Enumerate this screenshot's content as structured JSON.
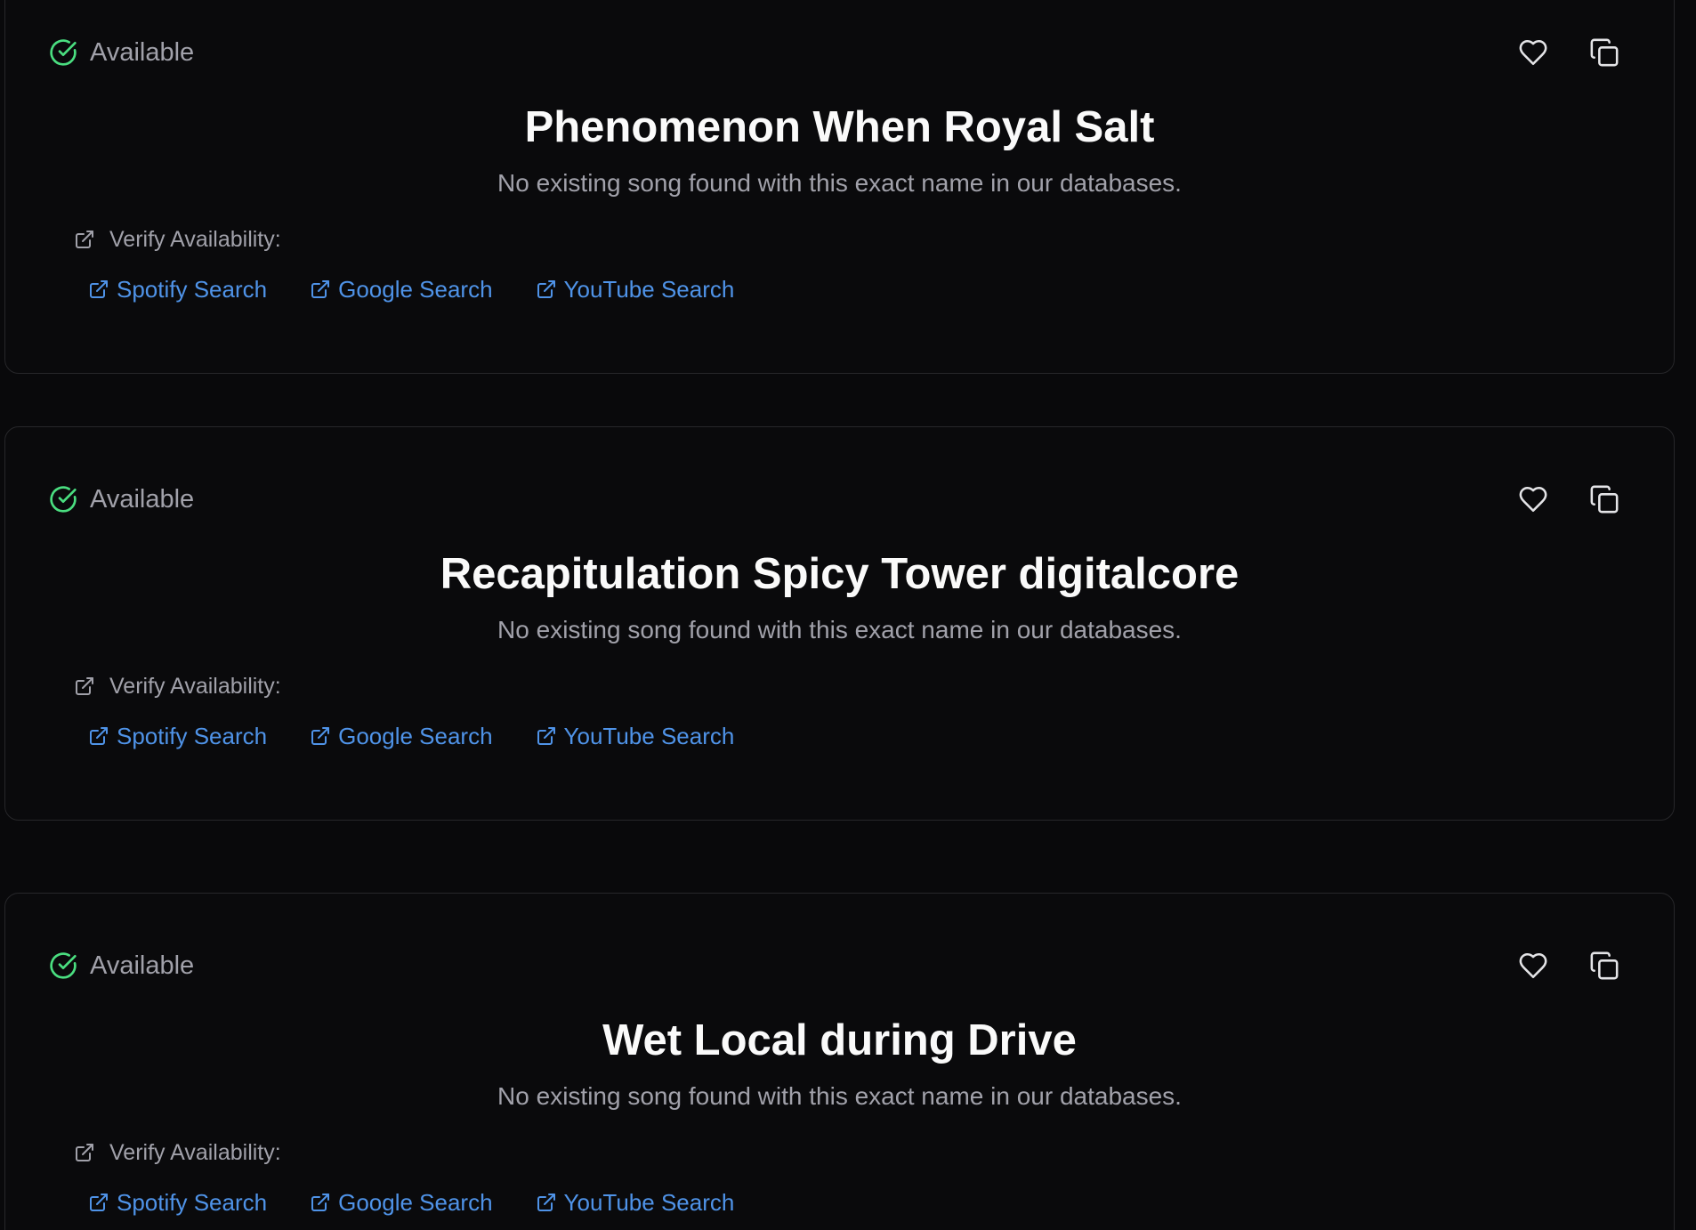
{
  "colors": {
    "background": "#09090b",
    "card_border": "#27272a",
    "available": "#4ade80",
    "link": "#4f93e8",
    "muted_text": "#a1a1aa",
    "title_text": "#fafafa"
  },
  "icons": {
    "status": "check-circle-icon",
    "favorite": "heart-icon",
    "copy": "copy-icon",
    "external": "external-link-icon"
  },
  "cards": [
    {
      "status": "Available",
      "title": "Phenomenon When Royal Salt",
      "description": "No existing song found with this exact name in our databases.",
      "verify_label": "Verify Availability:",
      "links": [
        "Spotify Search",
        "Google Search",
        "YouTube Search"
      ]
    },
    {
      "status": "Available",
      "title": "Recapitulation Spicy Tower digitalcore",
      "description": "No existing song found with this exact name in our databases.",
      "verify_label": "Verify Availability:",
      "links": [
        "Spotify Search",
        "Google Search",
        "YouTube Search"
      ]
    },
    {
      "status": "Available",
      "title": "Wet Local during Drive",
      "description": "No existing song found with this exact name in our databases.",
      "verify_label": "Verify Availability:",
      "links": [
        "Spotify Search",
        "Google Search",
        "YouTube Search"
      ]
    }
  ]
}
